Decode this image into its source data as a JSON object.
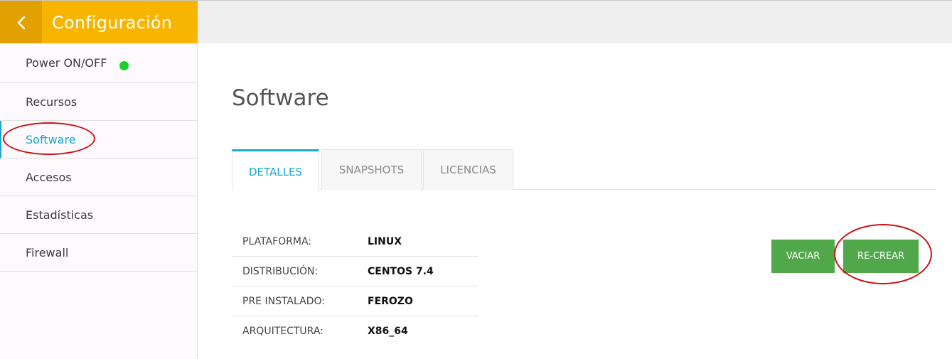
{
  "header": {
    "back_icon": "chevron-left-icon",
    "title": "Configuración"
  },
  "sidebar": {
    "items": [
      {
        "label": "Power ON/OFF",
        "status_color": "#19d32a"
      },
      {
        "label": "Recursos"
      },
      {
        "label": "Software",
        "active": true
      },
      {
        "label": "Accesos"
      },
      {
        "label": "Estadísticas"
      },
      {
        "label": "Firewall"
      }
    ]
  },
  "main": {
    "title": "Software",
    "tabs": [
      {
        "label": "DETALLES",
        "active": true
      },
      {
        "label": "SNAPSHOTS"
      },
      {
        "label": "LICENCIAS"
      }
    ],
    "details": [
      {
        "label": "PLATAFORMA:",
        "value": "LINUX"
      },
      {
        "label": "DISTRIBUCIÓN:",
        "value": "CENTOS 7.4"
      },
      {
        "label": "PRE INSTALADO:",
        "value": "FEROZO"
      },
      {
        "label": "ARQUITECTURA:",
        "value": "X86_64"
      }
    ],
    "buttons": {
      "vaciar": "VACIAR",
      "recrear": "RE-CREAR"
    }
  },
  "colors": {
    "accent": "#1aa7c9",
    "header_yellow": "#f7b500",
    "header_dark_yellow": "#e2a100",
    "button_green": "#51a84a",
    "annotation_red": "#cc1111"
  }
}
